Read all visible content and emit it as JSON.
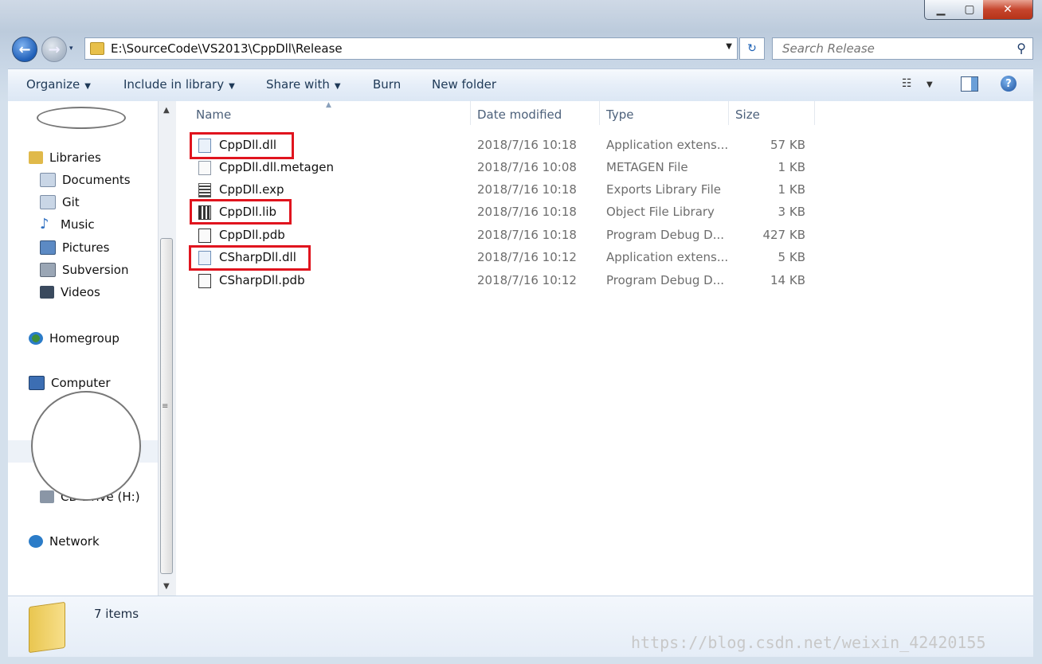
{
  "window": {
    "controls": {
      "minimize": "▁",
      "maximize": "▢",
      "close": "✕"
    }
  },
  "nav": {
    "back": "←",
    "forward": "→",
    "recent": "▾"
  },
  "address": {
    "path": "E:\\SourceCode\\VS2013\\CppDll\\Release",
    "dropdown": "▼",
    "refresh": "↻"
  },
  "search": {
    "placeholder": "Search Release",
    "icon": "magnifier-icon"
  },
  "toolbar": {
    "organize": "Organize",
    "include": "Include in library",
    "share": "Share with",
    "burn": "Burn",
    "new_folder": "New folder",
    "arrow": "▼",
    "views_icon": "☷",
    "help": "?"
  },
  "sidebar": {
    "items": [
      {
        "label": "Libraries",
        "icon": "libraries-icon",
        "color": "#e0b94a"
      },
      {
        "label": "Documents",
        "icon": "documents-icon",
        "color": "#c9d6e6"
      },
      {
        "label": "Git",
        "icon": "git-icon",
        "color": "#c9d6e6"
      },
      {
        "label": "Music",
        "icon": "music-icon",
        "color": "#2f6fc0"
      },
      {
        "label": "Pictures",
        "icon": "pictures-icon",
        "color": "#5c8ac4"
      },
      {
        "label": "Subversion",
        "icon": "subversion-icon",
        "color": "#9aa6b5"
      },
      {
        "label": "Videos",
        "icon": "videos-icon",
        "color": "#3a4a5e"
      },
      {
        "label": "Homegroup",
        "icon": "homegroup-icon",
        "color": "#3e8e3a"
      },
      {
        "label": "Computer",
        "icon": "computer-icon",
        "color": "#3c6eb3"
      },
      {
        "label": "CD Drive (H:)",
        "icon": "cd-drive-icon",
        "color": "#8a96a6"
      },
      {
        "label": "Network",
        "icon": "network-icon",
        "color": "#2b7cc8"
      }
    ],
    "scroll": {
      "up": "▲",
      "down": "▼",
      "grip": "≡"
    }
  },
  "columns": {
    "name": "Name",
    "date": "Date modified",
    "type": "Type",
    "size": "Size",
    "sort": "▲"
  },
  "files": [
    {
      "name": "CppDll.dll",
      "date": "2018/7/16 10:18",
      "type": "Application extens...",
      "size": "57 KB"
    },
    {
      "name": "CppDll.dll.metagen",
      "date": "2018/7/16 10:08",
      "type": "METAGEN File",
      "size": "1 KB"
    },
    {
      "name": "CppDll.exp",
      "date": "2018/7/16 10:18",
      "type": "Exports Library File",
      "size": "1 KB"
    },
    {
      "name": "CppDll.lib",
      "date": "2018/7/16 10:18",
      "type": "Object File Library",
      "size": "3 KB"
    },
    {
      "name": "CppDll.pdb",
      "date": "2018/7/16 10:18",
      "type": "Program Debug D...",
      "size": "427 KB"
    },
    {
      "name": "CSharpDll.dll",
      "date": "2018/7/16 10:12",
      "type": "Application extens...",
      "size": "5 KB"
    },
    {
      "name": "CSharpDll.pdb",
      "date": "2018/7/16 10:12",
      "type": "Program Debug D...",
      "size": "14 KB"
    }
  ],
  "status": {
    "count": "7 items"
  },
  "watermark": "https://blog.csdn.net/weixin_42420155",
  "colors": {
    "highlight": "#e0141e",
    "accent": "#1a5fb4"
  }
}
